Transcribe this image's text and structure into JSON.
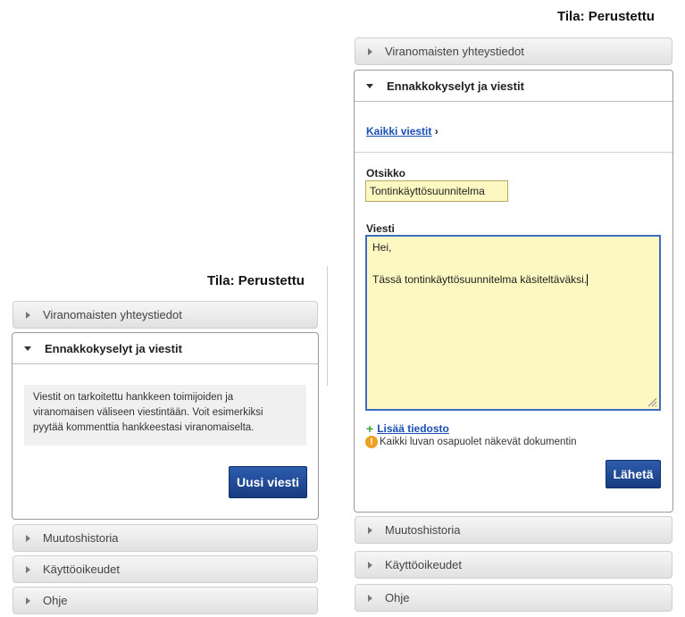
{
  "left": {
    "status": "Tila: Perustettu",
    "sections": {
      "contacts": "Viranomaisten yhteystiedot",
      "messages": "Ennakkokyselyt ja viestit",
      "history": "Muutoshistoria",
      "rights": "Käyttöoikeudet",
      "help": "Ohje"
    },
    "info_lines": [
      "Viestit on tarkoitettu hankkeen toimijoiden ja",
      "viranomaisen väliseen viestintään. Voit esimerkiksi",
      "pyytää kommenttia hankkeestasi viranomaiselta."
    ],
    "new_message_button": "Uusi viesti"
  },
  "right": {
    "status": "Tila: Perustettu",
    "sections": {
      "contacts": "Viranomaisten yhteystiedot",
      "messages": "Ennakkokyselyt ja viestit",
      "history": "Muutoshistoria",
      "rights": "Käyttöoikeudet",
      "help": "Ohje"
    },
    "all_messages_link": "Kaikki viestit",
    "all_messages_arrow": "›",
    "subject_label": "Otsikko",
    "subject_value": "Tontinkäyttösuunnitelma",
    "message_label": "Viesti",
    "message_lines": [
      "Hei,",
      "",
      "Tässä tontinkäyttösuunnitelma käsiteltäväksi."
    ],
    "add_file_plus": "+",
    "add_file_link": "Lisää tiedosto",
    "notice_text": "Kaikki luvan osapuolet näkevät dokumentin",
    "send_button": "Lähetä"
  },
  "colors": {
    "accent_blue": "#1f4a99",
    "field_yellow": "#fdf7c1",
    "warning_orange": "#f0a020",
    "plus_green": "#3aa63a"
  }
}
